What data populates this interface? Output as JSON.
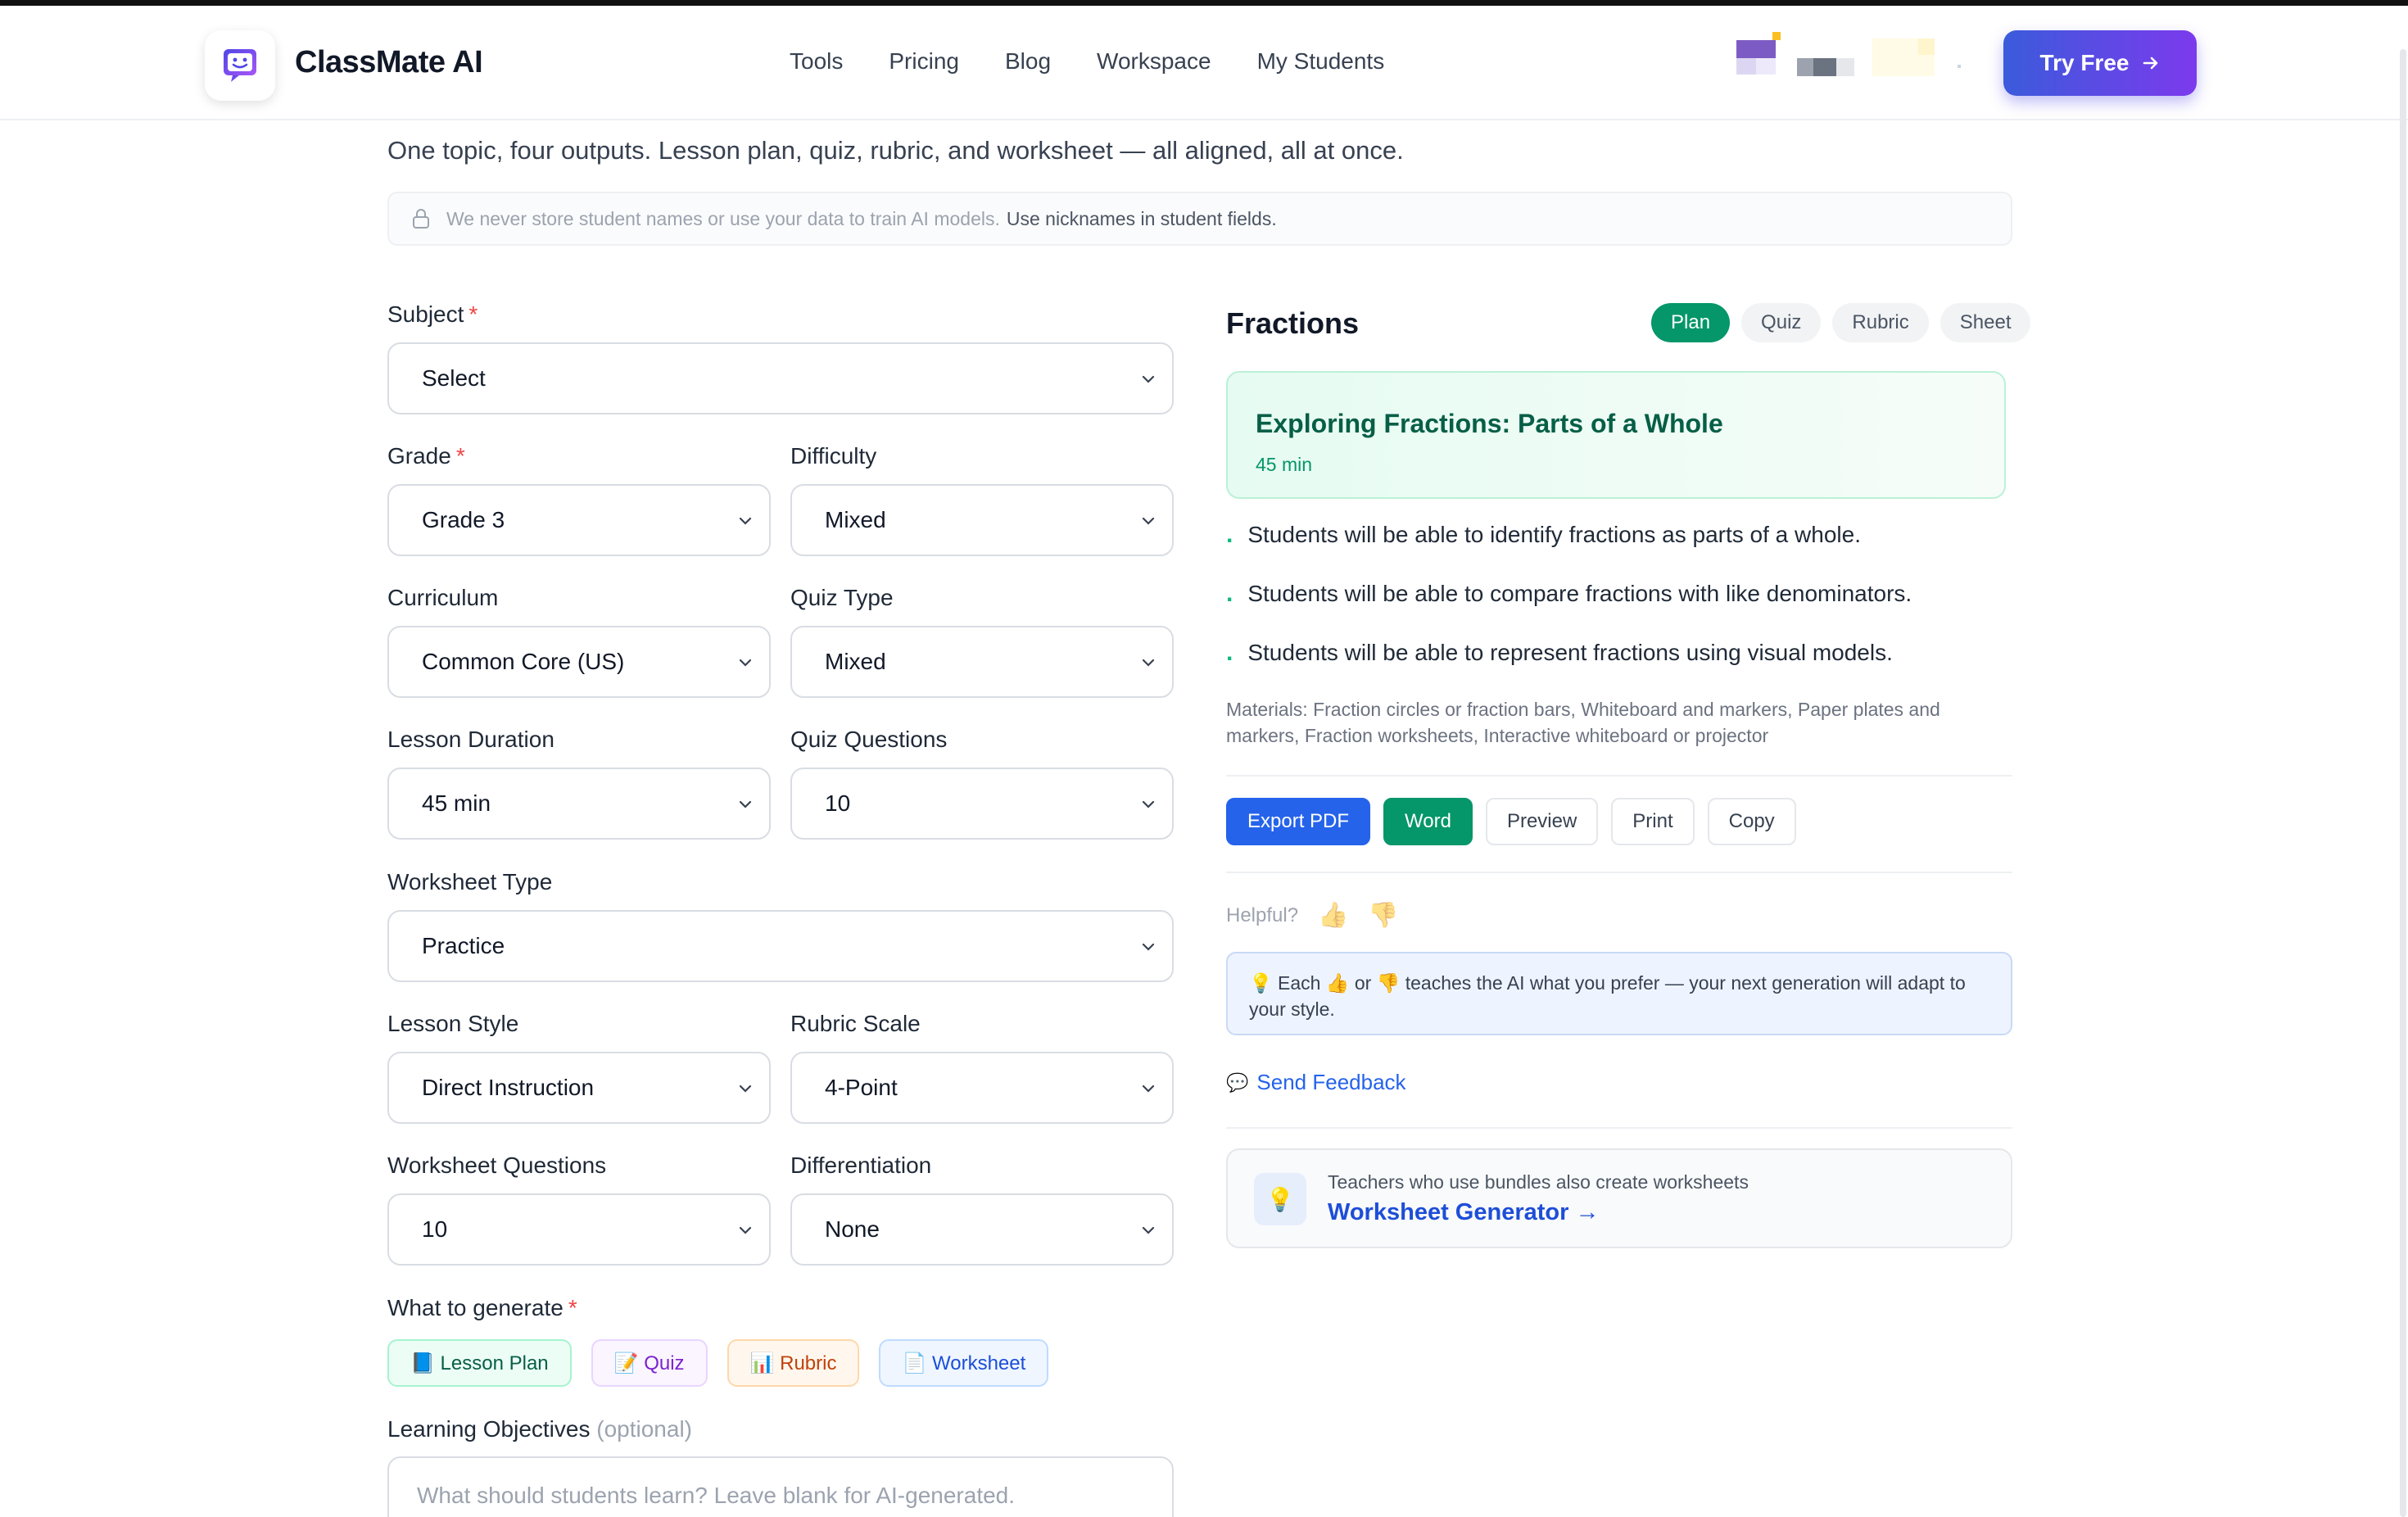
{
  "brand": {
    "name": "ClassMate AI",
    "accent": "#4f46e5"
  },
  "nav": [
    "Tools",
    "Pricing",
    "Blog",
    "Workspace",
    "My Students"
  ],
  "cta": {
    "label": "Try Free",
    "icon": "arrow-right-icon"
  },
  "intro": {
    "subtitle": "One topic, four outputs. Lesson plan, quiz, rubric, and worksheet — all aligned, all at once.",
    "privacy": "We never store student names or use your data to train AI models.",
    "privacy_strong": "Use nicknames in student fields."
  },
  "form": {
    "subject": {
      "label": "Subject",
      "value": "Select"
    },
    "grade": {
      "label": "Grade",
      "value": "Grade 3"
    },
    "difficulty": {
      "label": "Difficulty",
      "value": "Mixed"
    },
    "curriculum": {
      "label": "Curriculum",
      "value": "Common Core (US)"
    },
    "quiz_type": {
      "label": "Quiz Type",
      "value": "Mixed"
    },
    "lesson_duration": {
      "label": "Lesson Duration",
      "value": "45 min"
    },
    "quiz_questions": {
      "label": "Quiz Questions",
      "value": "10"
    },
    "worksheet_type": {
      "label": "Worksheet Type",
      "value": "Practice"
    },
    "lesson_style": {
      "label": "Lesson Style",
      "value": "Direct Instruction"
    },
    "rubric_scale": {
      "label": "Rubric Scale",
      "value": "4-Point"
    },
    "worksheet_questions": {
      "label": "Worksheet Questions",
      "value": "10"
    },
    "differentiation": {
      "label": "Differentiation",
      "value": "None"
    },
    "required_mark": "*",
    "generate": {
      "label": "What to generate",
      "chips": [
        "📘 Lesson Plan",
        "📝 Quiz",
        "📊 Rubric",
        "📄 Worksheet"
      ]
    },
    "objectives": {
      "label": "Learning Objectives",
      "optional": "(optional)",
      "placeholder": "What should students learn? Leave blank for AI-generated."
    }
  },
  "preview": {
    "topic": "Fractions",
    "tabs": [
      "Plan",
      "Quiz",
      "Rubric",
      "Sheet"
    ],
    "plan_title": "Exploring Fractions: Parts of a Whole",
    "duration": "45 min",
    "objectives": [
      "Students will be able to identify fractions as parts of a whole.",
      "Students will be able to compare fractions with like denominators.",
      "Students will be able to represent fractions using visual models."
    ],
    "materials": "Materials: Fraction circles or fraction bars, Whiteboard and markers, Paper plates and markers, Fraction worksheets, Interactive whiteboard or projector",
    "actions": [
      "Export PDF",
      "Word",
      "Preview",
      "Print",
      "Copy"
    ],
    "helpful": "Helpful?",
    "tip": "💡 Each 👍 or 👎 teaches the AI what you prefer — your next generation will adapt to your style.",
    "feedback": "Send Feedback",
    "promo_sub": "Teachers who use bundles also create worksheets",
    "promo_link": "Worksheet Generator →"
  }
}
